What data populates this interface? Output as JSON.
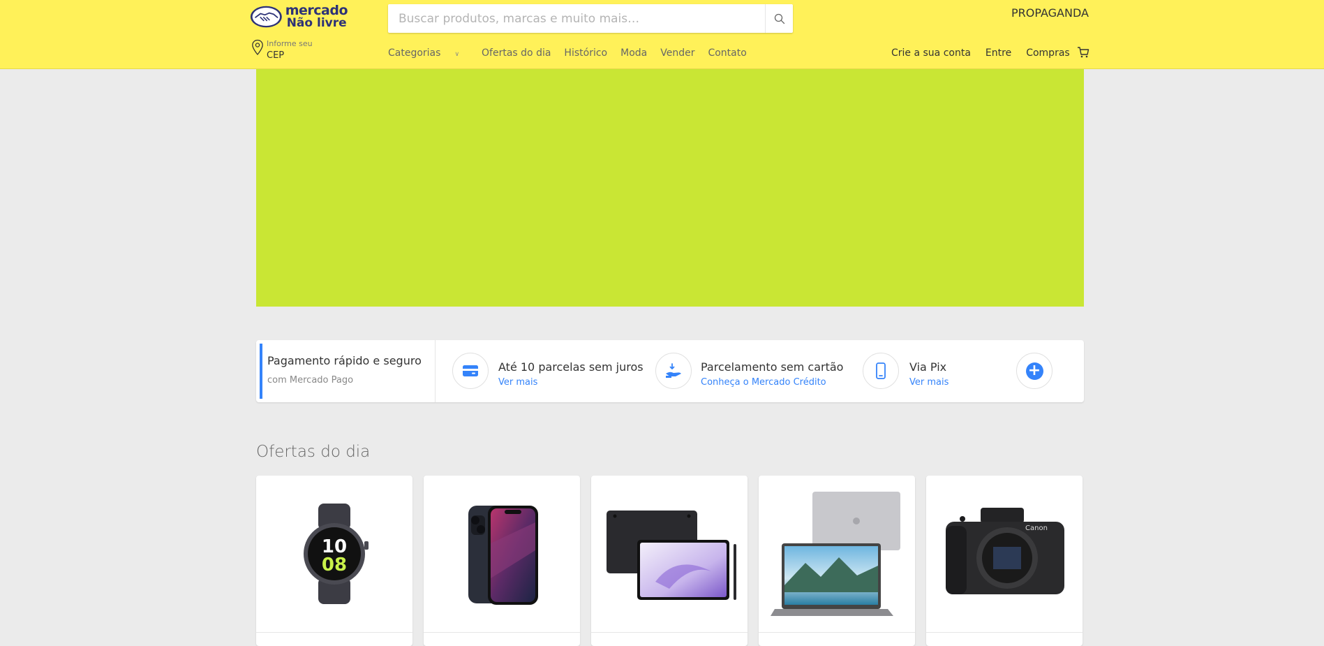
{
  "header": {
    "logo": {
      "line1": "mercado",
      "line2": "Não livre"
    },
    "search": {
      "placeholder": "Buscar produtos, marcas e muito mais…"
    },
    "promo_link": "PROPAGANDA",
    "cep": {
      "label": "Informe seu",
      "value": "CEP"
    },
    "nav": {
      "categorias": "Categorias",
      "ofertas": "Ofertas do dia",
      "historico": "Histórico",
      "moda": "Moda",
      "vender": "Vender",
      "contato": "Contato"
    },
    "account": {
      "signup": "Crie a sua conta",
      "login": "Entre",
      "purchases": "Compras"
    }
  },
  "payment": {
    "title": "Pagamento rápido e seguro",
    "subtitle": "com Mercado Pago",
    "options": [
      {
        "title": "Até 10 parcelas sem juros",
        "link": "Ver mais",
        "icon": "credit-card-icon"
      },
      {
        "title": "Parcelamento sem cartão",
        "link": "Conheça o Mercado Crédito",
        "icon": "hand-money-icon"
      },
      {
        "title": "Via Pix",
        "link": "Ver mais",
        "icon": "phone-icon"
      }
    ],
    "more_icon": "plus-icon"
  },
  "offers": {
    "title": "Ofertas do dia",
    "products": [
      {
        "icon": "smartwatch-image",
        "watch_time": [
          "10",
          "08"
        ]
      },
      {
        "icon": "smartphone-image"
      },
      {
        "icon": "tablet-image"
      },
      {
        "icon": "laptop-image"
      },
      {
        "icon": "camera-image",
        "brand": "Canon"
      }
    ]
  },
  "colors": {
    "header_bg": "#fff159",
    "banner_bg": "#c9e634",
    "accent_blue": "#3483fa",
    "logo_navy": "#2d3277"
  }
}
